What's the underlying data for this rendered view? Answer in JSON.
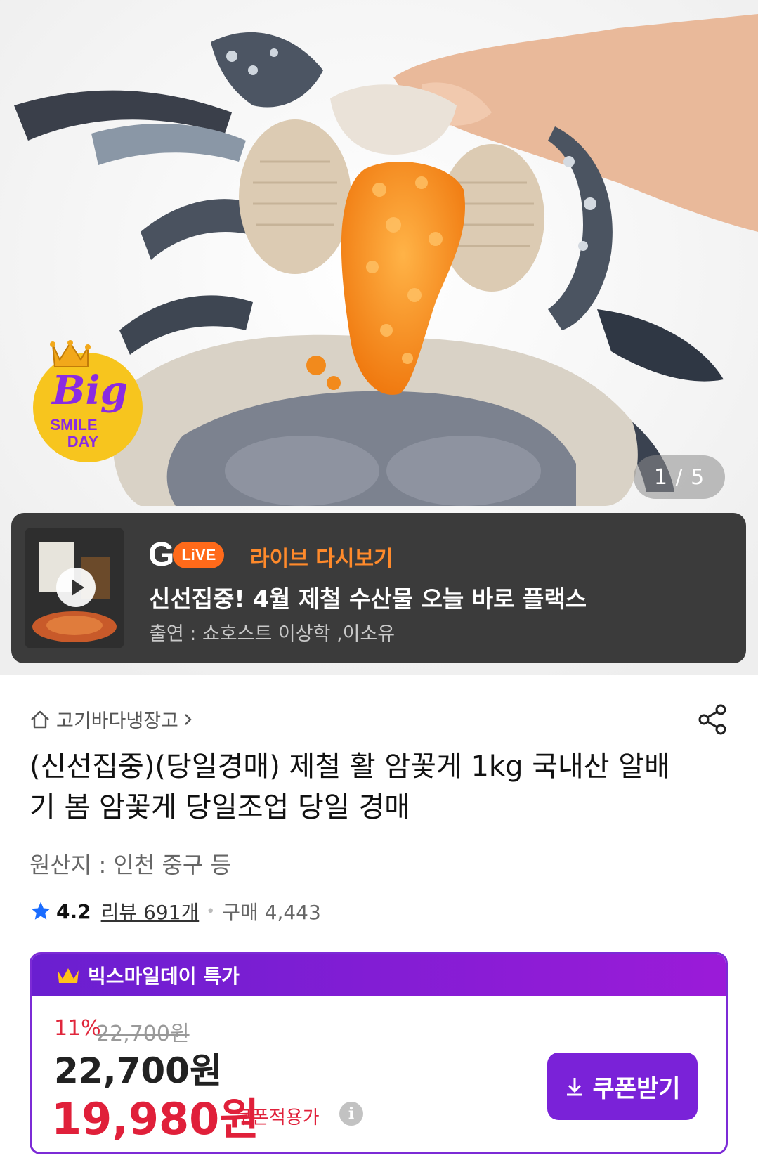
{
  "gallery": {
    "counter": "1 / 5",
    "badge": {
      "crown": "crown-icon",
      "big": "Big",
      "line1": "SMILE",
      "line2": "DAY"
    }
  },
  "live": {
    "g": "G",
    "pill": "LiVE",
    "replay": "라이브 다시보기",
    "title": "신선집중! 4월 제철 수산물 오늘 바로 플랙스",
    "cast": "출연 : 쇼호스트 이상학 ,이소유"
  },
  "product": {
    "breadcrumb": "고기바다냉장고",
    "title": "(신선집중)(당일경매) 제철 활 암꽃게 1kg 국내산 알배기 봄 암꽃게 당일조업 당일 경매",
    "origin": "원산지 : 인천 중구 등",
    "rating": "4.2",
    "reviews": "리뷰 691개",
    "purchases": "구매 4,443"
  },
  "deal": {
    "header": "빅스마일데이 특가",
    "discount": "11%",
    "original_price": "22,700원",
    "price": "22,700원",
    "sale_price": "19,980원",
    "coupon_label": "쿠폰적용가",
    "coupon_button": "쿠폰받기"
  },
  "colors": {
    "accent": "#7a22d8",
    "sale": "#e0203a",
    "live": "#ff6a1a"
  }
}
